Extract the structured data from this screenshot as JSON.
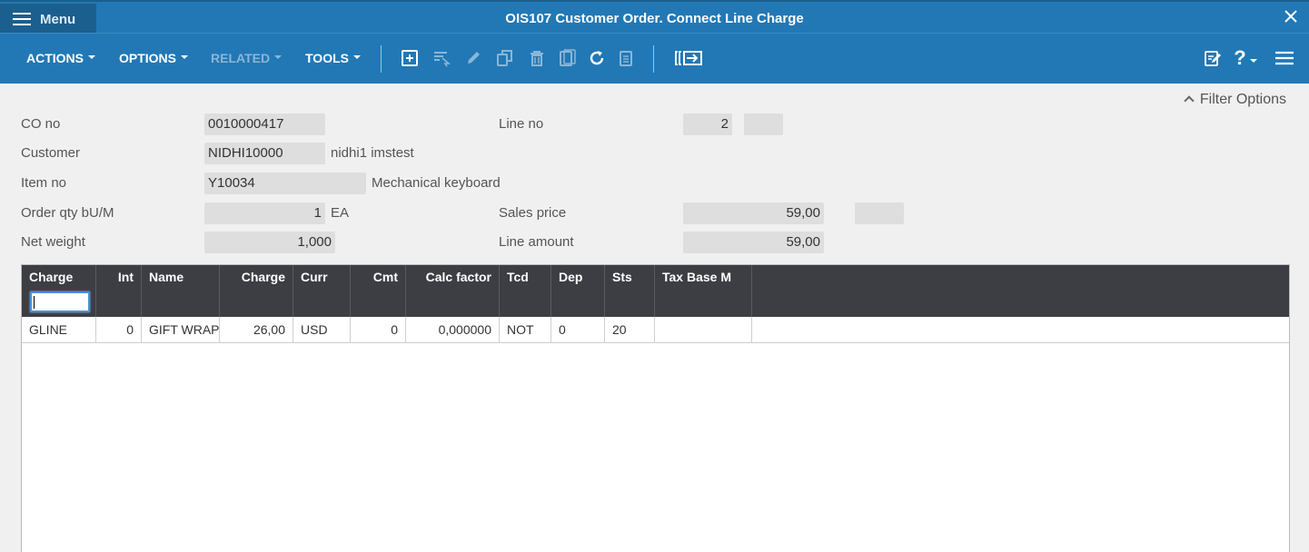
{
  "window": {
    "menu_label": "Menu",
    "title": "OIS107 Customer Order. Connect Line Charge"
  },
  "toolbar": {
    "actions": "ACTIONS",
    "options": "OPTIONS",
    "related": "RELATED",
    "tools": "TOOLS",
    "icons": [
      "add-icon",
      "select-icon",
      "edit-icon",
      "copy-icon",
      "delete-icon",
      "display-icon",
      "refresh-icon",
      "clipboard-icon",
      "navigate-icon",
      "notes-icon",
      "help-icon",
      "more-menu-icon"
    ],
    "help_label": "?"
  },
  "filter_options": "Filter Options",
  "form": {
    "co_no": {
      "label": "CO no",
      "value": "0010000417"
    },
    "line_no": {
      "label": "Line no",
      "value": "2",
      "suffix": ""
    },
    "customer": {
      "label": "Customer",
      "value": "NIDHI10000",
      "desc": "nidhi1 imstest"
    },
    "item_no": {
      "label": "Item no",
      "value": "Y10034",
      "desc": "Mechanical keyboard"
    },
    "order_qty": {
      "label": "Order qty bU/M",
      "value": "1",
      "unit": "EA"
    },
    "sales_price": {
      "label": "Sales price",
      "value": "59,00",
      "extra": ""
    },
    "net_weight": {
      "label": "Net weight",
      "value": "1,000"
    },
    "line_amount": {
      "label": "Line amount",
      "value": "59,00"
    }
  },
  "grid": {
    "columns": [
      "Charge",
      "Int",
      "Name",
      "Charge",
      "Curr",
      "Cmt",
      "Calc factor",
      "Tcd",
      "Dep",
      "Sts",
      "Tax Base M"
    ],
    "filter_value": "",
    "rows": [
      [
        "GLINE",
        "0",
        "GIFT WRAP",
        "26,00",
        "USD",
        "0",
        "0,000000",
        "NOT",
        "0",
        "20",
        ""
      ]
    ]
  },
  "colors": {
    "header_blue": "#2278b5",
    "menu_dark_blue": "#1b5f8f",
    "grid_header": "#3d3e43",
    "background": "#f0f0f0"
  }
}
